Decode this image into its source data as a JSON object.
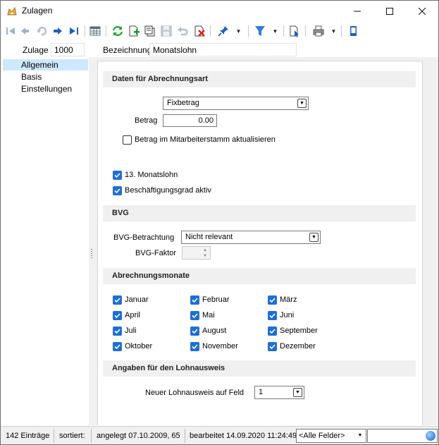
{
  "window": {
    "title": "Zulagen"
  },
  "header": {
    "zulage_label": "Zulage",
    "zulage_value": "1000",
    "bezeichnung_label": "Bezeichnung",
    "bezeichnung_value": "Monatslohn"
  },
  "nav": {
    "items": [
      {
        "label": "Allgemein"
      },
      {
        "label": "Basis"
      },
      {
        "label": "Einstellungen"
      }
    ]
  },
  "sections": {
    "abrechnungsart": {
      "title": "Daten für Abrechnungsart",
      "art_value": "Fixbetrag",
      "betrag_label": "Betrag",
      "betrag_value": "0.00",
      "update_label": "Betrag im Mitarbeiterstamm aktualisieren",
      "monatslohn13_label": "13. Monatslohn",
      "beschgrad_label": "Beschäftigungsgrad aktiv"
    },
    "bvg": {
      "title": "BVG",
      "betrachtung_label": "BVG-Betrachtung",
      "betrachtung_value": "Nicht relevant",
      "faktor_label": "BVG-Faktor"
    },
    "monate": {
      "title": "Abrechnungsmonate",
      "months": [
        "Januar",
        "Februar",
        "März",
        "April",
        "Mai",
        "Juni",
        "Juli",
        "August",
        "September",
        "Oktober",
        "November",
        "Dezember"
      ]
    },
    "lohnausweis": {
      "title": "Angaben für den Lohnausweis",
      "feld_label": "Neuer Lohnausweis auf Feld",
      "feld_value": "1"
    }
  },
  "status": {
    "count": "142 Einträge",
    "sorted": "sortiert:",
    "created": "angelegt 07.10.2009, 65",
    "edited": "bearbeitet 14.09.2020 11:24:49,",
    "filter_value": "<Alle Felder>"
  },
  "colors": {
    "accent": "#1f6fd1",
    "selection": "#cde8ff",
    "section_bg": "#f0f0f0"
  }
}
